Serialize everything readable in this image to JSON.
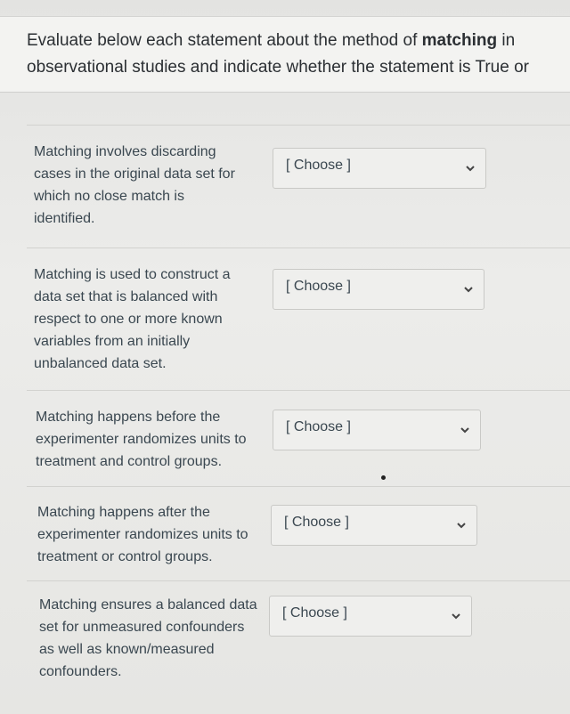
{
  "instructions": {
    "part1": "Evaluate below each statement about the method of ",
    "emphasis": "matching",
    "part2": " in",
    "line2": "observational studies and indicate whether the statement is True or"
  },
  "placeholder": "[ Choose ]",
  "statements": [
    {
      "lines": [
        "Matching involves discarding",
        "cases in the original data set for",
        "which no close match is",
        "identified."
      ],
      "selected": "[ Choose ]"
    },
    {
      "lines": [
        "Matching is used to construct a",
        "data set that is balanced with",
        "respect to one or more known",
        "variables from an initially",
        "unbalanced data set."
      ],
      "selected": "[ Choose ]"
    },
    {
      "lines": [
        "Matching happens before the",
        "experimenter randomizes units to",
        "treatment and control groups."
      ],
      "selected": "[ Choose ]"
    },
    {
      "lines": [
        "Matching happens after the",
        "experimenter randomizes units to",
        "treatment or control groups."
      ],
      "selected": "[ Choose ]"
    },
    {
      "lines": [
        "Matching ensures a balanced data",
        "set for unmeasured confounders",
        "as well as known/measured",
        "confounders."
      ],
      "selected": "[ Choose ]"
    }
  ]
}
